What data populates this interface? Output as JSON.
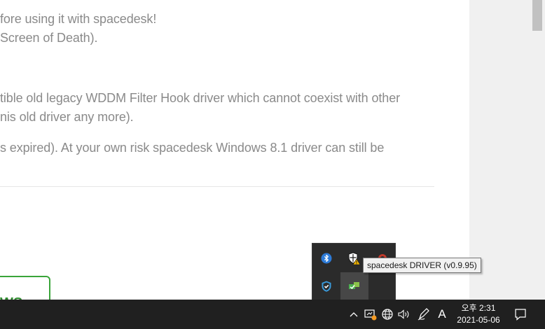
{
  "page": {
    "paragraphs": [
      "fore using it with spacedesk!",
      " Screen of Death).",
      "tible old legacy WDDM Filter Hook driver which cannot coexist with other",
      "nis old driver any more).",
      "s expired). At your own risk spacedesk Windows 8.1 driver can still be"
    ],
    "green_button_label": "WS"
  },
  "tooltip": {
    "text": "spacedesk DRIVER (v0.9.95)"
  },
  "tray_icons": [
    "bluetooth-icon",
    "windows-security-warning-icon",
    "app-icon",
    "defender-shield-icon",
    "spacedesk-driver-icon"
  ],
  "taskbar": {
    "clock_time": "오후 2:31",
    "clock_date": "2021-05-06",
    "ime_label": "A",
    "icons": [
      "show-hidden-icons-chevron",
      "network-warning-icon",
      "language-globe-icon",
      "volume-icon",
      "pen-icon",
      "ime-icon",
      "notifications-icon"
    ]
  },
  "colors": {
    "taskbar_bg": "#202020",
    "popup_bg": "#2b2b2b",
    "text_gray": "#8a8a8a",
    "accent_green": "#3aa53a",
    "bluetooth_blue": "#2d7bd8"
  }
}
